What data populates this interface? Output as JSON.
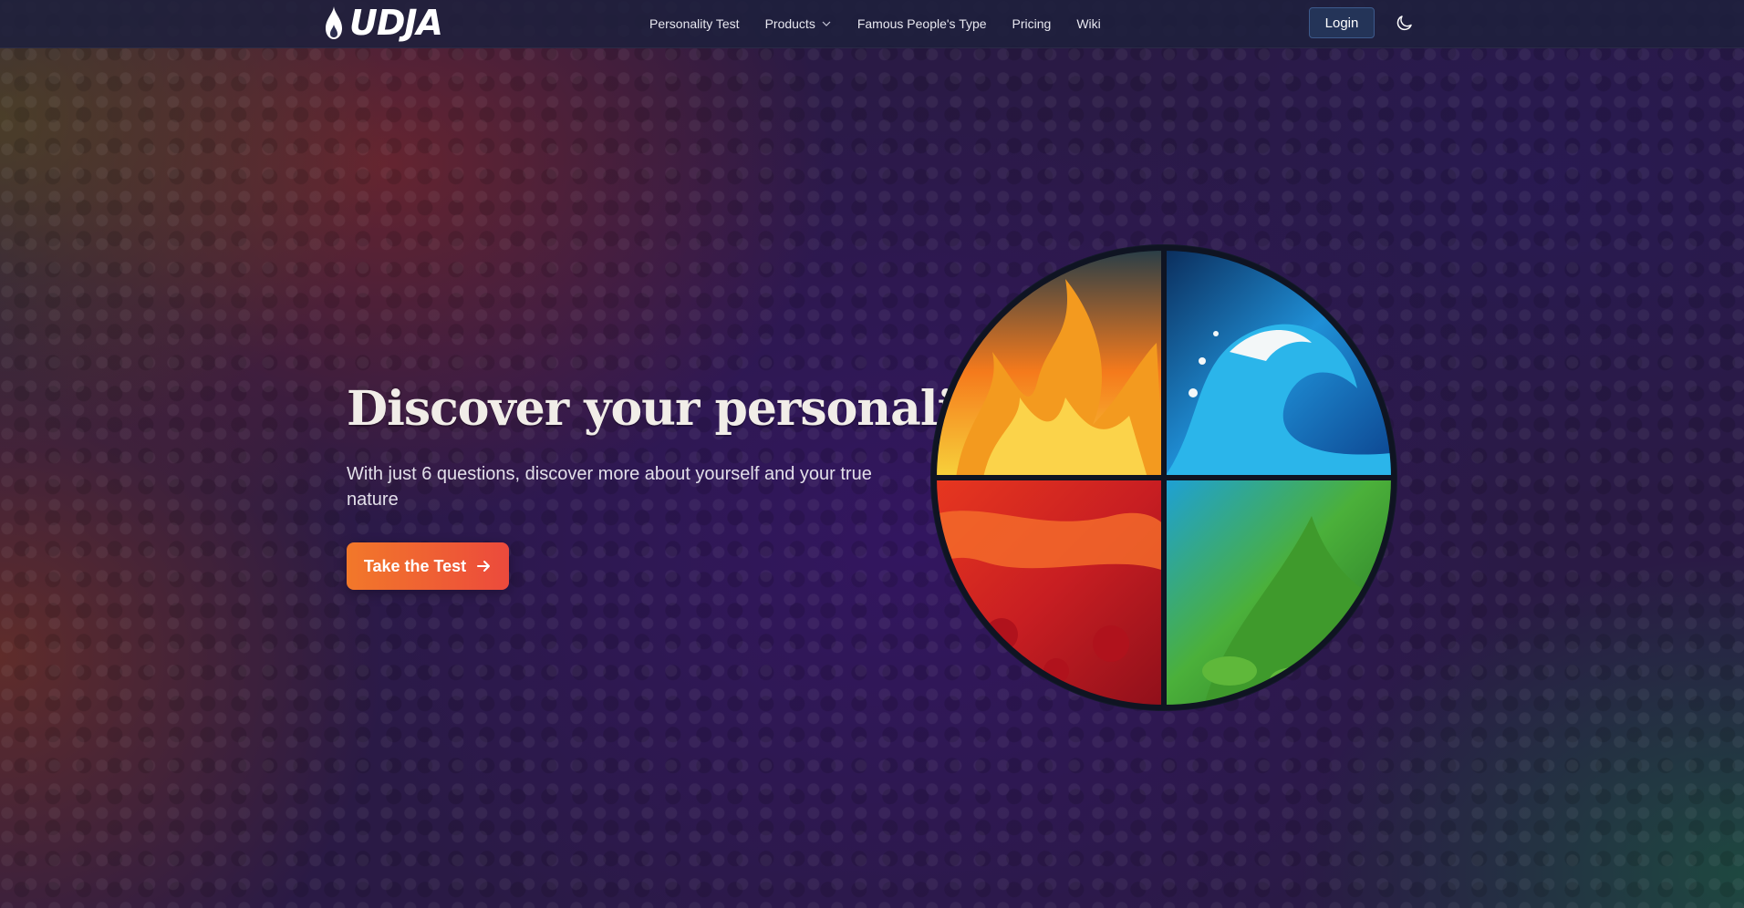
{
  "brand": {
    "name": "UDJA"
  },
  "nav": {
    "items": [
      {
        "label": "Personality Test"
      },
      {
        "label": "Products",
        "has_dropdown": true
      },
      {
        "label": "Famous People's Type"
      },
      {
        "label": "Pricing"
      },
      {
        "label": "Wiki"
      }
    ],
    "login_label": "Login",
    "theme_icon": "moon-icon"
  },
  "hero": {
    "title": "Discover your personality",
    "subtitle": "With just 6 questions, discover more about yourself and your true nature",
    "cta_label": "Take the Test",
    "cta_icon": "arrow-right-icon",
    "image_quadrants": [
      "fire",
      "water",
      "earth",
      "air"
    ]
  },
  "colors": {
    "cta_start": "#f2782a",
    "cta_end": "#ec4a3c",
    "navbar_bg": "#1e203c",
    "login_bg": "#243458"
  }
}
